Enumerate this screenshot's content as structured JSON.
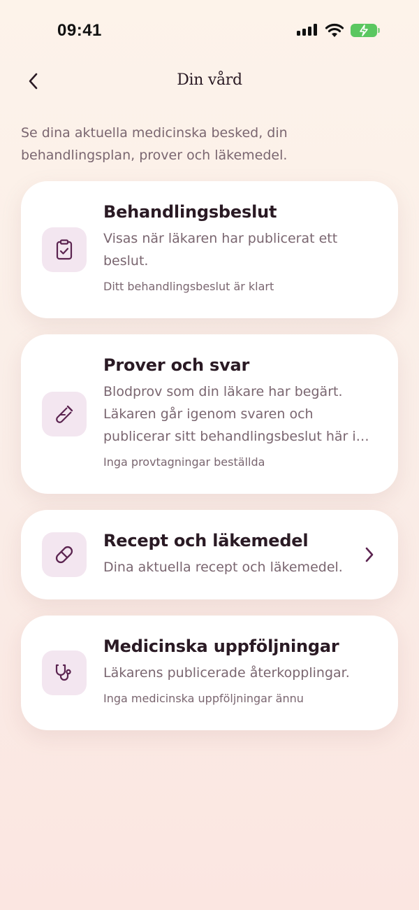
{
  "status_bar": {
    "time": "09:41"
  },
  "header": {
    "title": "Din vård",
    "back_icon": "chevron-left-icon"
  },
  "intro": "Se dina aktuella medicinska besked, din behandlingsplan, prover och läkemedel.",
  "cards": [
    {
      "title": "Behandlingsbeslut",
      "description": "Visas när läkaren har publicerat ett beslut.",
      "meta": "Ditt behandlingsbeslut är klart",
      "icon": "clipboard-check-icon"
    },
    {
      "title": "Prover och svar",
      "description": "Blodprov som din läkare har begärt. Läkaren går igenom svaren och publicerar sitt behandlingsbeslut här i appen.",
      "meta": "Inga provtagningar beställda",
      "icon": "test-tube-icon"
    },
    {
      "title": "Recept och läkemedel",
      "description": "Dina aktuella recept och läkemedel.",
      "icon": "pill-icon",
      "trailing_icon": "chevron-right-icon"
    },
    {
      "title": "Medicinska uppföljningar",
      "description": "Läkarens publicerade återkopplingar.",
      "meta": "Inga medicinska uppföljningar ännu",
      "icon": "stethoscope-icon"
    }
  ],
  "colors": {
    "accent": "#5b2450",
    "icon_bg": "#f3e6f0",
    "text_primary": "#2a1a24",
    "text_secondary": "#7a6670",
    "battery": "#5ac760"
  }
}
